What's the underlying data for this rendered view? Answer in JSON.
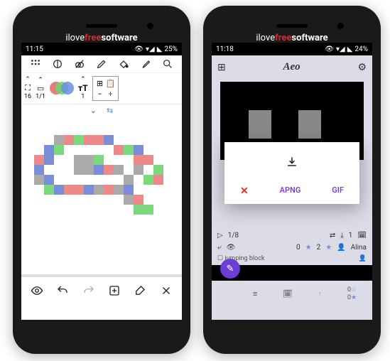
{
  "brand": {
    "pre": "ilove",
    "mid": "free",
    "post": "software"
  },
  "left": {
    "status": {
      "time": "11:15",
      "battery": "25%"
    },
    "tool2": {
      "frame": "16",
      "ratio": "1/1",
      "text_size": "1"
    },
    "grid": {
      "plus": "+"
    }
  },
  "right": {
    "status": {
      "time": "11:18",
      "battery": "24%"
    },
    "appbar": {
      "title": "Aeo"
    },
    "dialog": {
      "close": "✕",
      "option_apng": "APNG",
      "option_gif": "GIF"
    },
    "playback": {
      "frames": "1/8",
      "repeat": "1"
    },
    "stars": {
      "count0": "0",
      "count2": "2",
      "user": "Alina"
    },
    "label": "jumping block",
    "fab": "✎",
    "bot_count": "0"
  }
}
